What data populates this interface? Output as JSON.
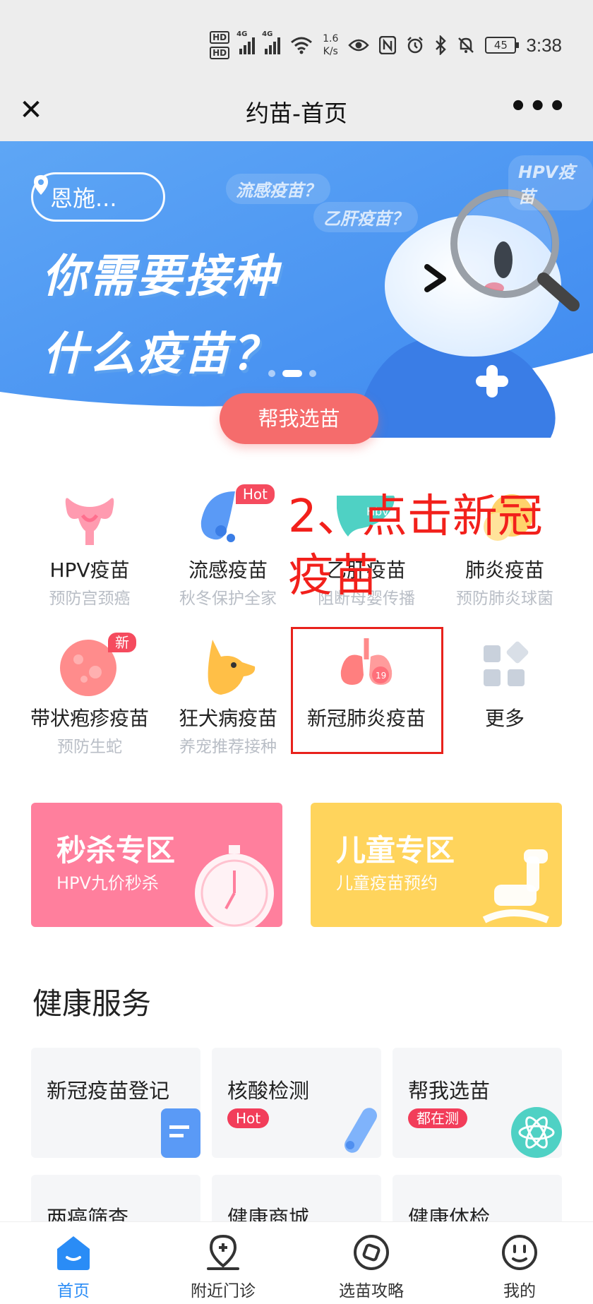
{
  "status": {
    "network": "4G",
    "speed_value": "1.6",
    "speed_unit": "K/s",
    "battery": "45",
    "time": "3:38"
  },
  "nav": {
    "title": "约苗-首页"
  },
  "banner": {
    "location": "恩施...",
    "headline_1": "你需要接种",
    "headline_2": "什么疫苗？",
    "tag_1": "流感疫苗？",
    "tag_2": "乙肝疫苗？",
    "tag_3": "HPV疫苗",
    "cta": "帮我选苗"
  },
  "categories": [
    {
      "name": "HPV疫苗",
      "sub": "预防宫颈癌",
      "icon": "uterus-icon"
    },
    {
      "name": "流感疫苗",
      "sub": "秋冬保护全家",
      "icon": "flu-icon",
      "badge": "Hot"
    },
    {
      "name": "乙肝疫苗",
      "sub": "阻断母婴传播",
      "icon": "liver-icon",
      "badge": "Hbv"
    },
    {
      "name": "肺炎疫苗",
      "sub": "预防肺炎球菌",
      "icon": "pneumonia-icon"
    },
    {
      "name": "带状疱疹疫苗",
      "sub": "预防生蛇",
      "icon": "shingles-icon",
      "badge": "新"
    },
    {
      "name": "狂犬病疫苗",
      "sub": "养宠推荐接种",
      "icon": "dog-icon"
    },
    {
      "name": "新冠肺炎疫苗",
      "sub": "",
      "icon": "lungs-icon",
      "badge": "19"
    },
    {
      "name": "更多",
      "sub": "",
      "icon": "more-icon"
    }
  ],
  "annotation": {
    "line_1": "2、点击新冠",
    "line_2": "疫苗"
  },
  "promos": [
    {
      "title": "秒杀专区",
      "sub": "HPV九价秒杀",
      "color": "#ff7f9d"
    },
    {
      "title": "儿童专区",
      "sub": "儿童疫苗预约",
      "color": "#ffd45c"
    }
  ],
  "health": {
    "title": "健康服务",
    "items": [
      {
        "label": "新冠疫苗登记",
        "tag": ""
      },
      {
        "label": "核酸检测",
        "tag": "Hot"
      },
      {
        "label": "帮我选苗",
        "tag": "都在测"
      },
      {
        "label": "两癌筛查",
        "tag": ""
      },
      {
        "label": "健康商城",
        "tag": ""
      },
      {
        "label": "健康体检",
        "tag": ""
      }
    ]
  },
  "tabs": [
    {
      "label": "首页",
      "active": true
    },
    {
      "label": "附近门诊"
    },
    {
      "label": "选苗攻略"
    },
    {
      "label": "我的"
    }
  ],
  "colors": {
    "accent": "#2a8cf6",
    "cta": "#f56c6c",
    "annotation": "#e8221c"
  }
}
